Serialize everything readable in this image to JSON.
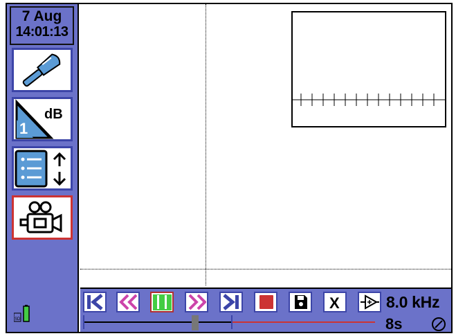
{
  "status": {
    "date": "7 Aug",
    "time": "14:01:13"
  },
  "sidebar": {
    "items": [
      {
        "name": "screwdriver-tool",
        "icon": "screwdriver-icon",
        "selected": false
      },
      {
        "name": "gain-db",
        "icon": "db-triangle-icon",
        "label": "dB",
        "value": "1",
        "selected": false
      },
      {
        "name": "list-scroll",
        "icon": "list-arrows-icon",
        "selected": false
      },
      {
        "name": "video-camera",
        "icon": "video-camera-icon",
        "selected": true
      }
    ],
    "storage": {
      "sd_label": "SD",
      "battery_level": 1.0
    }
  },
  "toolbar": {
    "buttons": [
      {
        "name": "skip-start",
        "icon": "skip-start-icon"
      },
      {
        "name": "rewind",
        "icon": "rewind-icon"
      },
      {
        "name": "pause",
        "icon": "pause-icon",
        "active": true
      },
      {
        "name": "fast-forward",
        "icon": "fast-forward-icon"
      },
      {
        "name": "skip-end",
        "icon": "skip-end-icon"
      },
      {
        "name": "stop",
        "icon": "stop-icon"
      },
      {
        "name": "save",
        "icon": "floppy-disk-icon"
      },
      {
        "name": "close",
        "icon": "x-icon",
        "label": "X"
      },
      {
        "name": "amplifier",
        "icon": "amplifier-icon"
      }
    ],
    "frequency": "8.0 kHz",
    "duration": "8s",
    "playback_position": 0.375,
    "gauge_icon": "gauge-icon"
  },
  "colors": {
    "panel": "#6b72c9",
    "button_border": "#3c45a8",
    "accent_magenta": "#cc44aa",
    "accent_green": "#44cc44",
    "stop_red": "#cc3333",
    "timeline_red": "#cc3333"
  }
}
